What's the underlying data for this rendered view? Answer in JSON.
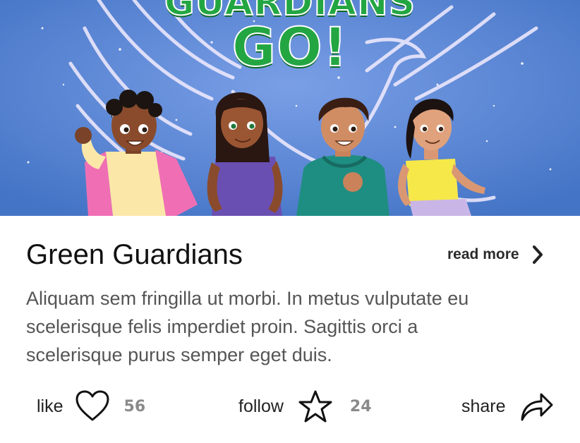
{
  "cover": {
    "logo_line1": "GUARDIANS",
    "logo_line2": "GO!",
    "background_color": "#4d7fcf",
    "logo_color": "#23a642"
  },
  "card": {
    "title": "Green Guardians",
    "read_more_label": "read more",
    "read_more_icon": "chevron-right-icon",
    "description": "Aliquam sem fringilla ut morbi. In metus vulputate eu scelerisque felis imperdiet proin. Sagittis orci a scelerisque purus semper eget duis."
  },
  "actions": {
    "like": {
      "label": "like",
      "icon": "heart-icon",
      "count": "56"
    },
    "follow": {
      "label": "follow",
      "icon": "star-icon",
      "count": "24"
    },
    "share": {
      "label": "share",
      "icon": "share-arrow-icon"
    }
  }
}
